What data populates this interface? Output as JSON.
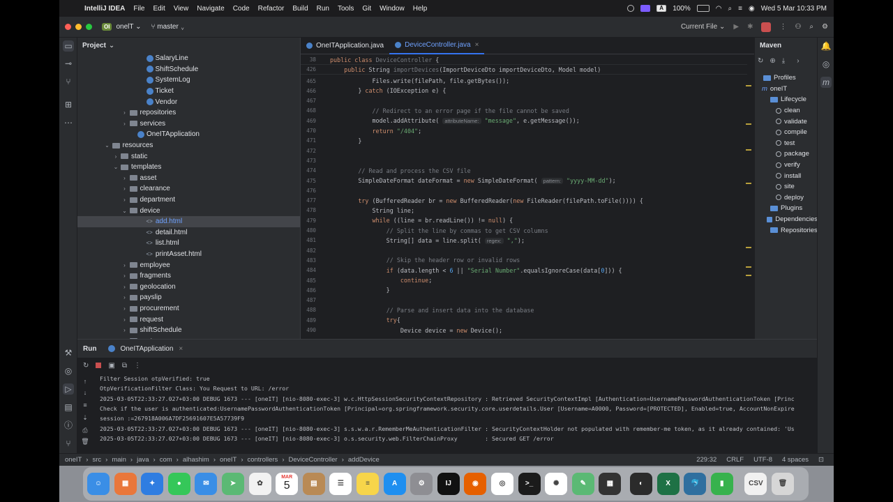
{
  "menubar": {
    "app_name": "IntelliJ IDEA",
    "items": [
      "File",
      "Edit",
      "View",
      "Navigate",
      "Code",
      "Refactor",
      "Build",
      "Run",
      "Tools",
      "Git",
      "Window",
      "Help"
    ],
    "battery": "100%",
    "clock": "Wed 5 Mar  10:33 PM",
    "keyboard_indicator": "A"
  },
  "toolbar": {
    "project_badge": "OI",
    "project_name": "onelT",
    "branch": "master",
    "run_config": "Current File"
  },
  "project_panel": {
    "title": "Project",
    "rows": [
      {
        "label": "SalaryLine",
        "kind": "class",
        "depth": 7,
        "arrow": ""
      },
      {
        "label": "ShiftSchedule",
        "kind": "class",
        "depth": 7,
        "arrow": ""
      },
      {
        "label": "SystemLog",
        "kind": "class",
        "depth": 7,
        "arrow": ""
      },
      {
        "label": "Ticket",
        "kind": "class",
        "depth": 7,
        "arrow": ""
      },
      {
        "label": "Vendor",
        "kind": "class",
        "depth": 7,
        "arrow": ""
      },
      {
        "label": "repositories",
        "kind": "folder",
        "depth": 5,
        "arrow": "right"
      },
      {
        "label": "services",
        "kind": "folder",
        "depth": 5,
        "arrow": "right"
      },
      {
        "label": "OneITApplication",
        "kind": "class",
        "depth": 6,
        "arrow": ""
      },
      {
        "label": "resources",
        "kind": "folder",
        "depth": 3,
        "arrow": "down"
      },
      {
        "label": "static",
        "kind": "folder",
        "depth": 4,
        "arrow": "right"
      },
      {
        "label": "templates",
        "kind": "folder",
        "depth": 4,
        "arrow": "down"
      },
      {
        "label": "asset",
        "kind": "folder",
        "depth": 5,
        "arrow": "right"
      },
      {
        "label": "clearance",
        "kind": "folder",
        "depth": 5,
        "arrow": "right"
      },
      {
        "label": "department",
        "kind": "folder",
        "depth": 5,
        "arrow": "right"
      },
      {
        "label": "device",
        "kind": "folder",
        "depth": 5,
        "arrow": "down"
      },
      {
        "label": "add.html",
        "kind": "html",
        "depth": 7,
        "arrow": "",
        "selected": true
      },
      {
        "label": "detail.html",
        "kind": "html",
        "depth": 7,
        "arrow": ""
      },
      {
        "label": "list.html",
        "kind": "html",
        "depth": 7,
        "arrow": ""
      },
      {
        "label": "printAsset.html",
        "kind": "html",
        "depth": 7,
        "arrow": ""
      },
      {
        "label": "employee",
        "kind": "folder",
        "depth": 5,
        "arrow": "right"
      },
      {
        "label": "fragments",
        "kind": "folder",
        "depth": 5,
        "arrow": "right"
      },
      {
        "label": "geolocation",
        "kind": "folder",
        "depth": 5,
        "arrow": "right"
      },
      {
        "label": "payslip",
        "kind": "folder",
        "depth": 5,
        "arrow": "right"
      },
      {
        "label": "procurement",
        "kind": "folder",
        "depth": 5,
        "arrow": "right"
      },
      {
        "label": "request",
        "kind": "folder",
        "depth": 5,
        "arrow": "right"
      },
      {
        "label": "shiftSchedule",
        "kind": "folder",
        "depth": 5,
        "arrow": "right"
      },
      {
        "label": "system",
        "kind": "folder",
        "depth": 5,
        "arrow": "right"
      }
    ]
  },
  "editor": {
    "tabs": [
      {
        "label": "OneITApplication.java",
        "active": false
      },
      {
        "label": "DeviceController.java",
        "active": true,
        "close": "×"
      }
    ],
    "warnings_count": "30",
    "sticky": [
      {
        "n": "38",
        "html": "<span class='kw'>public class</span> <span class='cm'>DeviceController</span> {"
      },
      {
        "n": "426",
        "html": "    <span class='kw'>public</span> String <span class='cm'>importDevices</span>(ImportDeviceDto importDeviceDto, Model model)"
      }
    ],
    "lines": [
      {
        "n": "465",
        "html": "            Files.write(filePath, file.getBytes());"
      },
      {
        "n": "466",
        "html": "        } <span class='kw'>catch</span> (IOException e) {"
      },
      {
        "n": "467",
        "html": ""
      },
      {
        "n": "468",
        "html": "            <span class='cm'>// Redirect to an error page if the file cannot be saved</span>"
      },
      {
        "n": "469",
        "html": "            model.addAttribute( <span class='hint'>attributeName:</span> <span class='str'>\"message\"</span>, e.getMessage());"
      },
      {
        "n": "470",
        "html": "            <span class='kw'>return</span> <span class='str'>\"/404\"</span>;"
      },
      {
        "n": "471",
        "html": "        }"
      },
      {
        "n": "472",
        "html": ""
      },
      {
        "n": "473",
        "html": ""
      },
      {
        "n": "474",
        "html": "        <span class='cm'>// Read and process the CSV file</span>"
      },
      {
        "n": "475",
        "html": "        SimpleDateFormat dateFormat = <span class='kw'>new</span> SimpleDateFormat( <span class='hint'>pattern:</span> <span class='str'>\"yyyy-MM-dd\"</span>);"
      },
      {
        "n": "476",
        "html": ""
      },
      {
        "n": "477",
        "html": "        <span class='kw'>try</span> (BufferedReader br = <span class='kw'>new</span> BufferedReader(<span class='kw'>new</span> FileReader(filePath.toFile()))) {"
      },
      {
        "n": "478",
        "html": "            String line;"
      },
      {
        "n": "479",
        "html": "            <span class='kw'>while</span> ((line = br.readLine()) != <span class='kw'>null</span>) {"
      },
      {
        "n": "480",
        "html": "                <span class='cm'>// Split the line by commas to get CSV columns</span>"
      },
      {
        "n": "481",
        "html": "                String[] data = line.split( <span class='hint'>regex:</span> <span class='str'>\",\"</span>);"
      },
      {
        "n": "482",
        "html": ""
      },
      {
        "n": "483",
        "html": "                <span class='cm'>// Skip the header row or invalid rows</span>"
      },
      {
        "n": "484",
        "html": "                <span class='kw'>if</span> (data.length < <span class='fn'>6</span> || <span class='str'>\"Serial Number\"</span>.equalsIgnoreCase(data[<span class='fn'>0</span>])) {"
      },
      {
        "n": "485",
        "html": "                    <span class='kw'>continue</span>;"
      },
      {
        "n": "486",
        "html": "                }"
      },
      {
        "n": "487",
        "html": ""
      },
      {
        "n": "488",
        "html": "                <span class='cm'>// Parse and insert data into the database</span>"
      },
      {
        "n": "489",
        "html": "                <span class='kw'>try</span>{"
      },
      {
        "n": "490",
        "html": "                    Device device = <span class='kw'>new</span> Device();"
      }
    ]
  },
  "maven": {
    "title": "Maven",
    "rows": [
      {
        "label": "Profiles",
        "kind": "folder",
        "indent": 1
      },
      {
        "label": "oneIT",
        "kind": "maven",
        "indent": 1
      },
      {
        "label": "Lifecycle",
        "kind": "folder",
        "indent": 2
      },
      {
        "label": "clean",
        "kind": "goal",
        "indent": 3
      },
      {
        "label": "validate",
        "kind": "goal",
        "indent": 3
      },
      {
        "label": "compile",
        "kind": "goal",
        "indent": 3
      },
      {
        "label": "test",
        "kind": "goal",
        "indent": 3
      },
      {
        "label": "package",
        "kind": "goal",
        "indent": 3
      },
      {
        "label": "verify",
        "kind": "goal",
        "indent": 3
      },
      {
        "label": "install",
        "kind": "goal",
        "indent": 3
      },
      {
        "label": "site",
        "kind": "goal",
        "indent": 3
      },
      {
        "label": "deploy",
        "kind": "goal",
        "indent": 3
      },
      {
        "label": "Plugins",
        "kind": "folder",
        "indent": 2
      },
      {
        "label": "Dependencies",
        "kind": "folder",
        "indent": 2
      },
      {
        "label": "Repositories",
        "kind": "folder",
        "indent": 2
      }
    ]
  },
  "run_panel": {
    "tab_run": "Run",
    "tab_app": "OneITApplication",
    "close": "×",
    "logs": [
      "Filter Session otpVerified: true",
      "OtpVerificationFilter Class: You Request to URL: /error",
      "2025-03-05T22:33:27.027+03:00 DEBUG 1673 --- [oneIT] [nio-8080-exec-3] w.c.HttpSessionSecurityContextRepository : Retrieved SecurityContextImpl [Authentication=UsernamePasswordAuthenticationToken [Princ",
      "Check if the user is authenticated:UsernamePasswordAuthenticationToken [Principal=org.springframework.security.core.userdetails.User [Username=A0000, Password=[PROTECTED], Enabled=true, AccountNonExpire",
      "session :=267918A006A7DF25691607E5A57739F9",
      "2025-03-05T22:33:27.027+03:00 DEBUG 1673 --- [oneIT] [nio-8080-exec-3] s.s.w.a.r.RememberMeAuthenticationFilter : SecurityContextHolder not populated with remember-me token, as it already contained: 'Us",
      "2025-03-05T22:33:27.027+03:00 DEBUG 1673 --- [oneIT] [nio-8080-exec-3] o.s.security.web.FilterChainProxy        : Secured GET /error"
    ]
  },
  "statusbar": {
    "breadcrumbs": [
      "oneIT",
      "src",
      "main",
      "java",
      "com",
      "alhashim",
      "oneIT",
      "controllers",
      "DeviceController",
      "addDevice"
    ],
    "position": "229:32",
    "line_ending": "CRLF",
    "encoding": "UTF-8",
    "indent": "4 spaces"
  },
  "dock": {
    "calendar_month": "MAR",
    "calendar_day": "5",
    "apps": [
      {
        "name": "finder-icon",
        "color": "#3a8ee6",
        "glyph": "☺"
      },
      {
        "name": "launchpad-icon",
        "color": "#e9773b",
        "glyph": "▦"
      },
      {
        "name": "safari-icon",
        "color": "#2f7de1",
        "glyph": "✦"
      },
      {
        "name": "messages-icon",
        "color": "#35c759",
        "glyph": "●"
      },
      {
        "name": "mail-icon",
        "color": "#3a8ee6",
        "glyph": "✉"
      },
      {
        "name": "maps-icon",
        "color": "#5bb974",
        "glyph": "➤"
      },
      {
        "name": "photos-icon",
        "color": "#f2f2f2",
        "glyph": "✿"
      },
      {
        "name": "calendar-icon",
        "color": "#ffffff",
        "glyph": ""
      },
      {
        "name": "contacts-icon",
        "color": "#b98a55",
        "glyph": "▤"
      },
      {
        "name": "reminders-icon",
        "color": "#ffffff",
        "glyph": "☰"
      },
      {
        "name": "notes-icon",
        "color": "#f7d54a",
        "glyph": "≡"
      },
      {
        "name": "app-store-icon",
        "color": "#1f8ff0",
        "glyph": "A"
      },
      {
        "name": "system-settings-icon",
        "color": "#8e8e93",
        "glyph": "⚙"
      },
      {
        "name": "intellij-icon",
        "color": "#111111",
        "glyph": "IJ"
      },
      {
        "name": "firefox-icon",
        "color": "#e66000",
        "glyph": "◉"
      },
      {
        "name": "chrome-icon",
        "color": "#ffffff",
        "glyph": "◎"
      },
      {
        "name": "terminal-icon",
        "color": "#1b1b1b",
        "glyph": ">_"
      },
      {
        "name": "chatgpt-icon",
        "color": "#ffffff",
        "glyph": "✺"
      },
      {
        "name": "numbers-chart-icon",
        "color": "#5bb974",
        "glyph": "✎"
      },
      {
        "name": "calculator-icon",
        "color": "#333333",
        "glyph": "▦"
      },
      {
        "name": "obs-icon",
        "color": "#2b2b2b",
        "glyph": "◐"
      },
      {
        "name": "excel-icon",
        "color": "#1e7145",
        "glyph": "X"
      },
      {
        "name": "mysql-workbench-icon",
        "color": "#2f6f9f",
        "glyph": "🐬"
      },
      {
        "name": "numbers-icon",
        "color": "#37b24d",
        "glyph": "▮"
      },
      {
        "name": "csv-file-icon",
        "color": "#f1f1f1",
        "glyph": "CSV"
      },
      {
        "name": "trash-icon",
        "color": "#d6d6d6",
        "glyph": "🗑"
      }
    ]
  }
}
